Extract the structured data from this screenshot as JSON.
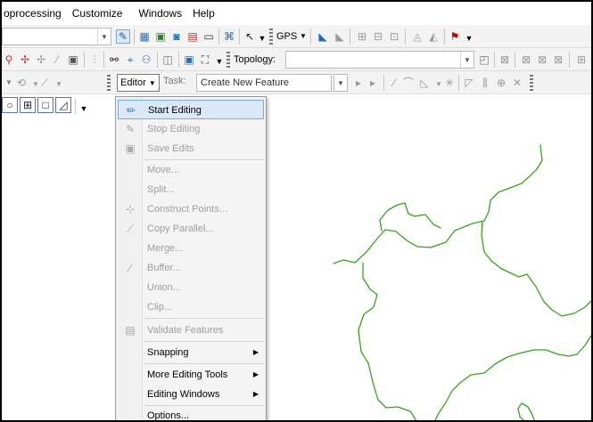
{
  "menubar": {
    "items": [
      "oprocessing",
      "Customize",
      "Windows",
      "Help"
    ]
  },
  "toolbar_standard": {
    "gps_label": "GPS"
  },
  "toolbar_topology": {
    "topology_label": "Topology:",
    "topology_value": ""
  },
  "toolbar_editor": {
    "editor_label": "Editor",
    "task_label": "Task:",
    "task_value": "Create New Feature"
  },
  "editor_menu": {
    "items": [
      {
        "label": "Start Editing",
        "icon": "pencil-icon",
        "enabled": true,
        "highlighted": true
      },
      {
        "label": "Stop Editing",
        "icon": "stop-edit-icon",
        "enabled": false
      },
      {
        "label": "Save Edits",
        "icon": "save-icon",
        "enabled": false
      },
      {
        "label": "Move...",
        "icon": "",
        "enabled": false
      },
      {
        "label": "Split...",
        "icon": "",
        "enabled": false
      },
      {
        "label": "Construct Points...",
        "icon": "construct-points-icon",
        "enabled": false
      },
      {
        "label": "Copy Parallel...",
        "icon": "copy-parallel-icon",
        "enabled": false
      },
      {
        "label": "Merge...",
        "icon": "",
        "enabled": false
      },
      {
        "label": "Buffer...",
        "icon": "buffer-icon",
        "enabled": false
      },
      {
        "label": "Union...",
        "icon": "",
        "enabled": false
      },
      {
        "label": "Clip...",
        "icon": "",
        "enabled": false
      },
      {
        "label": "Validate Features",
        "icon": "validate-icon",
        "enabled": false
      },
      {
        "label": "Snapping",
        "icon": "",
        "enabled": true,
        "submenu": true
      },
      {
        "label": "More Editing Tools",
        "icon": "",
        "enabled": true,
        "submenu": true
      },
      {
        "label": "Editing Windows",
        "icon": "",
        "enabled": true,
        "submenu": true
      },
      {
        "label": "Options...",
        "icon": "",
        "enabled": true
      }
    ]
  },
  "colors": {
    "feature_line": "#3aa11a",
    "highlight_bg": "#dbe8f7",
    "highlight_border": "#7fa8d8",
    "disabled_text": "#9e9e9e"
  }
}
